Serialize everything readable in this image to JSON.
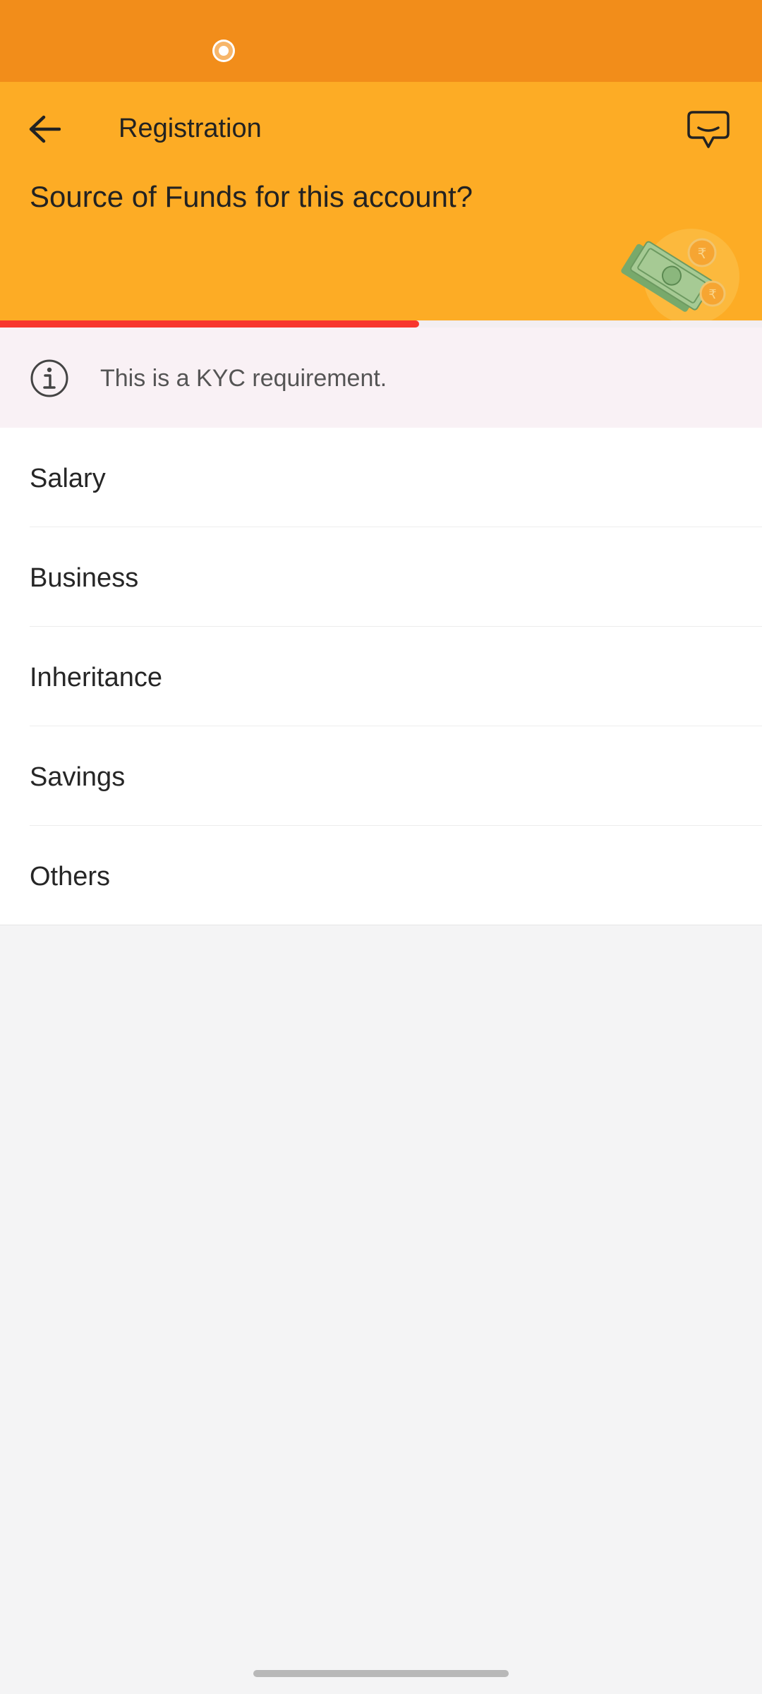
{
  "header": {
    "title": "Registration",
    "question": "Source of Funds for this account?"
  },
  "progress": {
    "fraction": 0.55
  },
  "kyc_notice": {
    "text": "This is a KYC requirement."
  },
  "options": [
    {
      "label": "Salary"
    },
    {
      "label": "Business"
    },
    {
      "label": "Inheritance"
    },
    {
      "label": "Savings"
    },
    {
      "label": "Others"
    }
  ],
  "icons": {
    "back": "arrow-left-icon",
    "chat": "chat-bubble-icon",
    "info": "info-icon",
    "illustration": "money-coins-illustration"
  },
  "colors": {
    "status_bar": "#f28d1a",
    "header": "#fdac25",
    "progress": "#f8362d",
    "banner": "#f9f1f5",
    "background": "#f4f4f5"
  }
}
